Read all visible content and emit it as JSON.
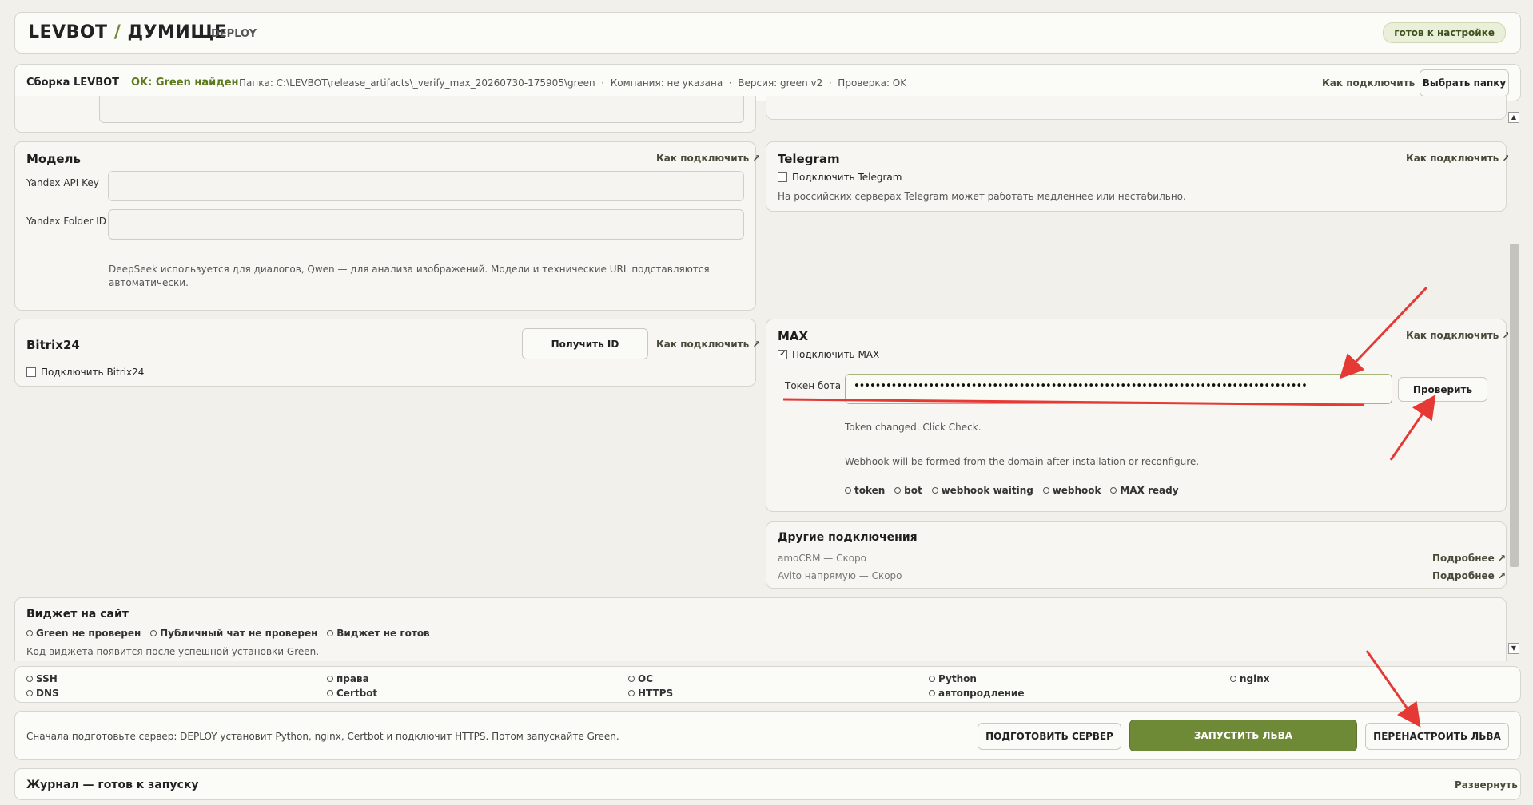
{
  "header": {
    "brand_left": "LEVBOT",
    "brand_sep": "/",
    "brand_right": "ДУМИЩЕ",
    "brand_sub": "DEPLOY",
    "status_badge": "готов к настройке"
  },
  "build_bar": {
    "title": "Сборка LEVBOT",
    "status": "OK: Green найден",
    "details": "Папка: C:\\LEVBOT\\release_artifacts\\_verify_max_20260730-175905\\green  ·  Компания: не указана  ·  Версия: green v2  ·  Проверка: OK",
    "connect_link": "Как подключить ↗",
    "choose_folder_button": "Выбрать папку"
  },
  "model": {
    "title": "Модель",
    "connect_link": "Как подключить ↗",
    "api_key_label": "Yandex API Key",
    "api_key_value": "",
    "folder_id_label": "Yandex Folder ID",
    "folder_id_value": "",
    "hint": "DeepSeek используется для диалогов, Qwen — для анализа изображений. Модели и технические URL подставляются автоматически."
  },
  "telegram": {
    "title": "Telegram",
    "connect_link": "Как подключить ↗",
    "checkbox_label": "Подключить Telegram",
    "checked": false,
    "note": "На российских серверах Telegram может работать медленнее или нестабильно."
  },
  "bitrix": {
    "title": "Bitrix24",
    "get_id_button": "Получить ID",
    "connect_link": "Как подключить ↗",
    "checkbox_label": "Подключить Bitrix24",
    "checked": false
  },
  "max": {
    "title": "MAX",
    "connect_link": "Как подключить ↗",
    "checkbox_label": "Подключить MAX",
    "checked": true,
    "token_label": "Токен бота",
    "token_value": "•••••••••••••••••••••••••••••••••••••••••••••••••••••••••••••••••••••••••••••••••••••",
    "check_button": "Проверить",
    "status_line": "Token changed. Click Check.",
    "webhook_note": "Webhook will be formed from the domain after installation or reconfigure.",
    "states": [
      "token",
      "bot",
      "webhook waiting",
      "webhook",
      "MAX ready"
    ]
  },
  "other": {
    "title": "Другие подключения",
    "items": [
      {
        "label": "amoCRM — Скоро",
        "link": "Подробнее ↗"
      },
      {
        "label": "Avito напрямую — Скоро",
        "link": "Подробнее ↗"
      }
    ]
  },
  "widget": {
    "title": "Виджет на сайт",
    "states": [
      "Green не проверен",
      "Публичный чат не проверен",
      "Виджет не готов"
    ],
    "note": "Код виджета появится после успешной установки Green."
  },
  "checks": {
    "col1": [
      "SSH",
      "DNS"
    ],
    "col2": [
      "права",
      "Certbot"
    ],
    "col3": [
      "OC",
      "HTTPS"
    ],
    "col4": [
      "Python",
      "автопродление"
    ],
    "col5": [
      "nginx"
    ]
  },
  "actions": {
    "hint": "Сначала подготовьте сервер: DEPLOY установит Python, nginx, Certbot и подключит HTTPS. Потом запускайте Green.",
    "prepare_button": "ПОДГОТОВИТЬ СЕРВЕР",
    "launch_button": "ЗАПУСТИТЬ ЛЬВА",
    "reconfigure_button": "ПЕРЕНАСТРОИТЬ ЛЬВА"
  },
  "journal": {
    "title": "Журнал — готов к запуску",
    "expand_link": "Развернуть"
  },
  "colors": {
    "accent": "#6f8a37",
    "annotation": "#e53935",
    "badge_bg": "#e9efd8"
  }
}
